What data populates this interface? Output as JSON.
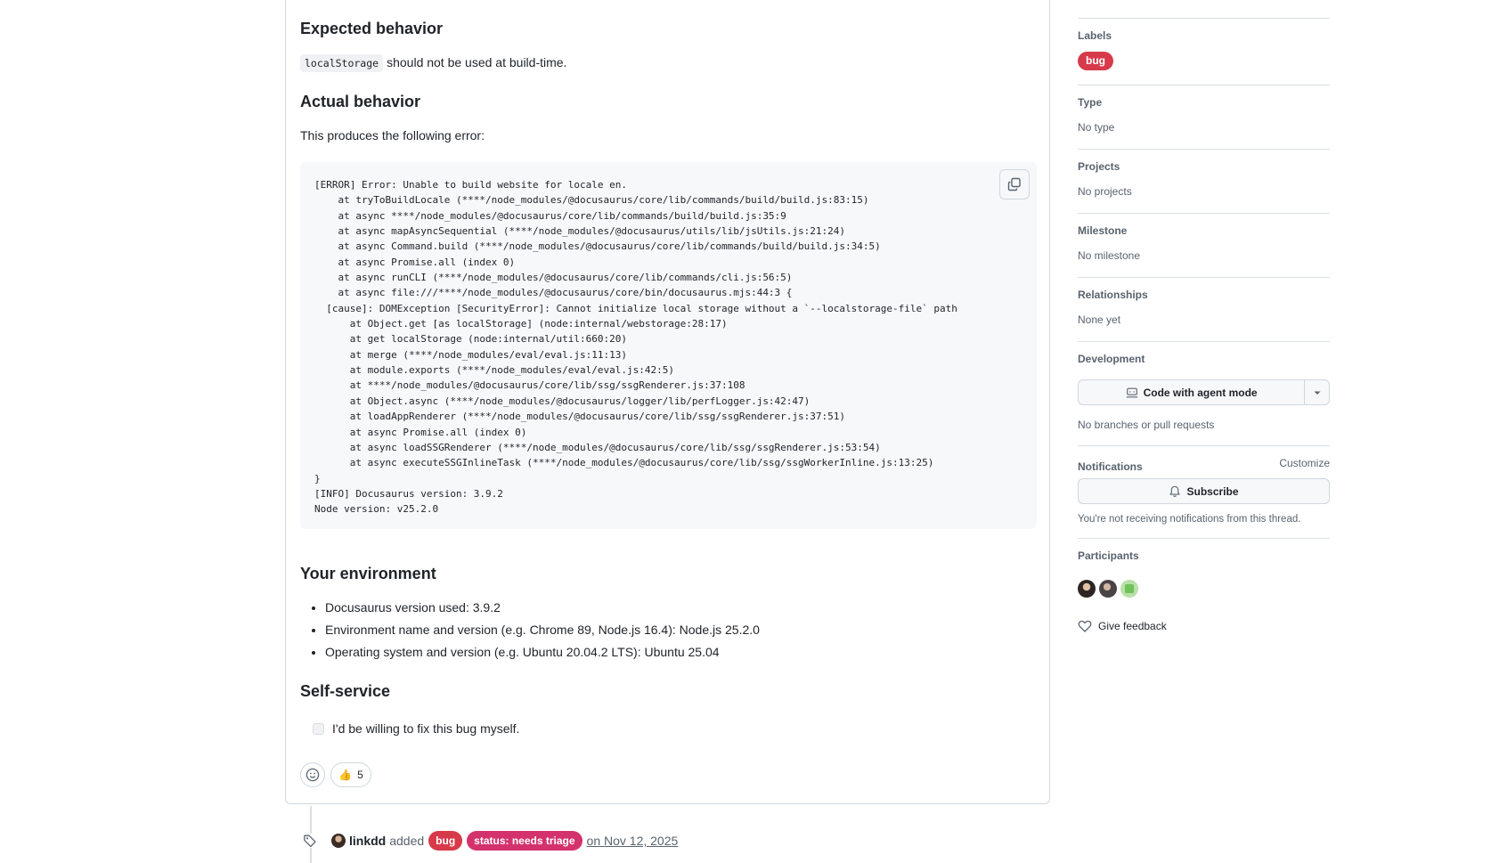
{
  "issue_body": {
    "expected_heading": "Expected behavior",
    "expected_code": "localStorage",
    "expected_text": "should not be used at build-time.",
    "actual_heading": "Actual behavior",
    "actual_intro": "This produces the following error:",
    "error_log": "[ERROR] Error: Unable to build website for locale en.\n    at tryToBuildLocale (****/node_modules/@docusaurus/core/lib/commands/build/build.js:83:15)\n    at async ****/node_modules/@docusaurus/core/lib/commands/build/build.js:35:9\n    at async mapAsyncSequential (****/node_modules/@docusaurus/utils/lib/jsUtils.js:21:24)\n    at async Command.build (****/node_modules/@docusaurus/core/lib/commands/build/build.js:34:5)\n    at async Promise.all (index 0)\n    at async runCLI (****/node_modules/@docusaurus/core/lib/commands/cli.js:56:5)\n    at async file:///****/node_modules/@docusaurus/core/bin/docusaurus.mjs:44:3 {\n  [cause]: DOMException [SecurityError]: Cannot initialize local storage without a `--localstorage-file` path\n      at Object.get [as localStorage] (node:internal/webstorage:28:17)\n      at get localStorage (node:internal/util:660:20)\n      at merge (****/node_modules/eval/eval.js:11:13)\n      at module.exports (****/node_modules/eval/eval.js:42:5)\n      at ****/node_modules/@docusaurus/core/lib/ssg/ssgRenderer.js:37:108\n      at Object.async (****/node_modules/@docusaurus/logger/lib/perfLogger.js:42:47)\n      at loadAppRenderer (****/node_modules/@docusaurus/core/lib/ssg/ssgRenderer.js:37:51)\n      at async Promise.all (index 0)\n      at async loadSSGRenderer (****/node_modules/@docusaurus/core/lib/ssg/ssgRenderer.js:53:54)\n      at async executeSSGInlineTask (****/node_modules/@docusaurus/core/lib/ssg/ssgWorkerInline.js:13:25)\n}\n[INFO] Docusaurus version: 3.9.2\nNode version: v25.2.0",
    "env_heading": "Your environment",
    "env_items": [
      "Docusaurus version used: 3.9.2",
      "Environment name and version (e.g. Chrome 89, Node.js 16.4): Node.js 25.2.0",
      "Operating system and version (e.g. Ubuntu 20.04.2 LTS): Ubuntu 25.04"
    ],
    "self_service_heading": "Self-service",
    "self_service_task": "I'd be willing to fix this bug myself.",
    "reaction_emoji": "👍",
    "reaction_count": "5"
  },
  "timeline_event": {
    "user": "linkdd",
    "action": "added",
    "labels": [
      {
        "name": "bug",
        "color": "#d73a4a"
      },
      {
        "name": "status: needs triage",
        "color": "#d4326c"
      }
    ],
    "date": "on Nov 12, 2025"
  },
  "sidebar": {
    "labels_title": "Labels",
    "label_bug": "bug",
    "type_title": "Type",
    "type_value": "No type",
    "projects_title": "Projects",
    "projects_value": "No projects",
    "milestone_title": "Milestone",
    "milestone_value": "No milestone",
    "relationships_title": "Relationships",
    "relationships_value": "None yet",
    "development_title": "Development",
    "agent_button": "Code with agent mode",
    "development_value": "No branches or pull requests",
    "notifications_title": "Notifications",
    "customize_link": "Customize",
    "subscribe_button": "Subscribe",
    "notifications_text": "You're not receiving notifications from this thread.",
    "participants_title": "Participants",
    "feedback_link": "Give feedback"
  }
}
